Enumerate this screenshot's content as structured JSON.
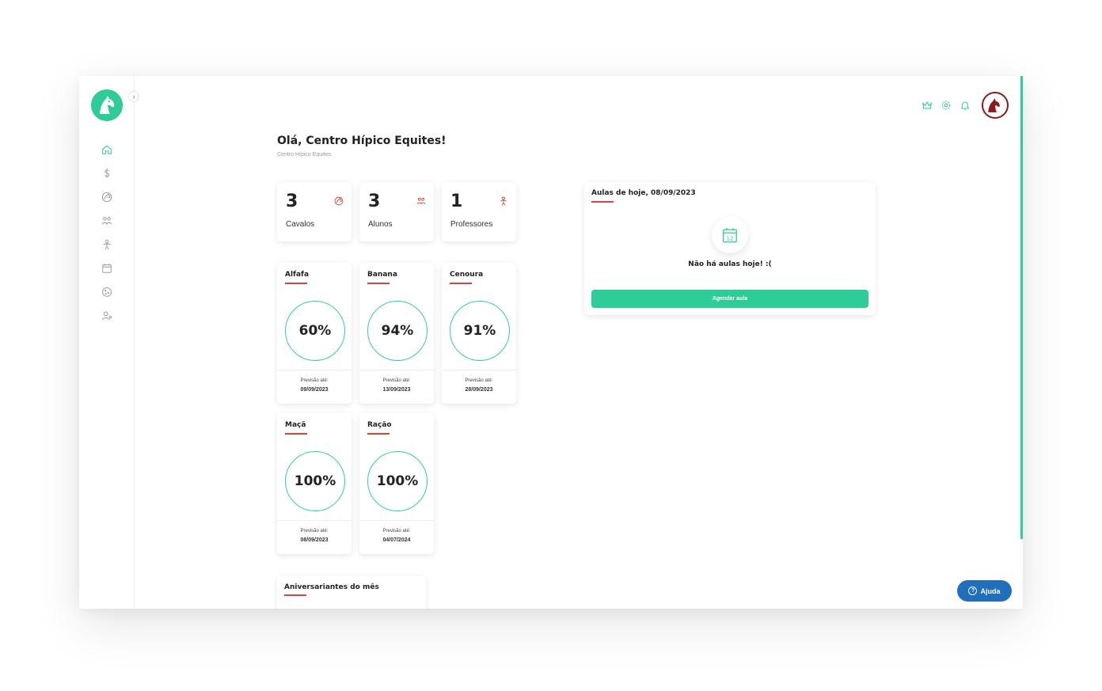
{
  "header": {
    "greeting": "Olá, Centro Hípico Equites!",
    "subtitle": "Centro Hípico Equites"
  },
  "sidebar": {
    "items": [
      {
        "icon": "home-icon"
      },
      {
        "icon": "dollar-icon"
      },
      {
        "icon": "horse-icon"
      },
      {
        "icon": "students-icon"
      },
      {
        "icon": "teacher-icon"
      },
      {
        "icon": "calendar-icon"
      },
      {
        "icon": "cookie-icon"
      },
      {
        "icon": "user-settings-icon"
      }
    ]
  },
  "topbar": {
    "icons": [
      "crown-icon",
      "settings-icon",
      "bell-icon"
    ]
  },
  "stats": [
    {
      "value": "3",
      "label": "Cavalos",
      "icon": "horse-icon"
    },
    {
      "value": "3",
      "label": "Alunos",
      "icon": "students-icon"
    },
    {
      "value": "1",
      "label": "Professores",
      "icon": "teacher-icon"
    }
  ],
  "feeds": [
    {
      "name": "Alfafa",
      "percent": "60%",
      "forecast_label": "Previsão até:",
      "forecast_date": "09/09/2023"
    },
    {
      "name": "Banana",
      "percent": "94%",
      "forecast_label": "Previsão até:",
      "forecast_date": "13/09/2023"
    },
    {
      "name": "Cenoura",
      "percent": "91%",
      "forecast_label": "Previsão até:",
      "forecast_date": "28/09/2023"
    },
    {
      "name": "Maçã",
      "percent": "100%",
      "forecast_label": "Previsão até:",
      "forecast_date": "08/09/2023"
    },
    {
      "name": "Ração",
      "percent": "100%",
      "forecast_label": "Previsão até:",
      "forecast_date": "04/07/2024"
    }
  ],
  "lessons": {
    "title": "Aulas de hoje, 08/09/2023",
    "calendar_day": "12",
    "empty_message": "Não há aulas hoje! :(",
    "button_label": "Agendar aula"
  },
  "birthdays": {
    "title": "Aniversariantes do mês"
  },
  "help": {
    "label": "Ajuda",
    "icon_glyph": "?"
  },
  "colors": {
    "accent": "#2ecc96",
    "danger": "#d9443a",
    "help": "#1f6fbd",
    "brand_dark": "#8b1a1a"
  }
}
